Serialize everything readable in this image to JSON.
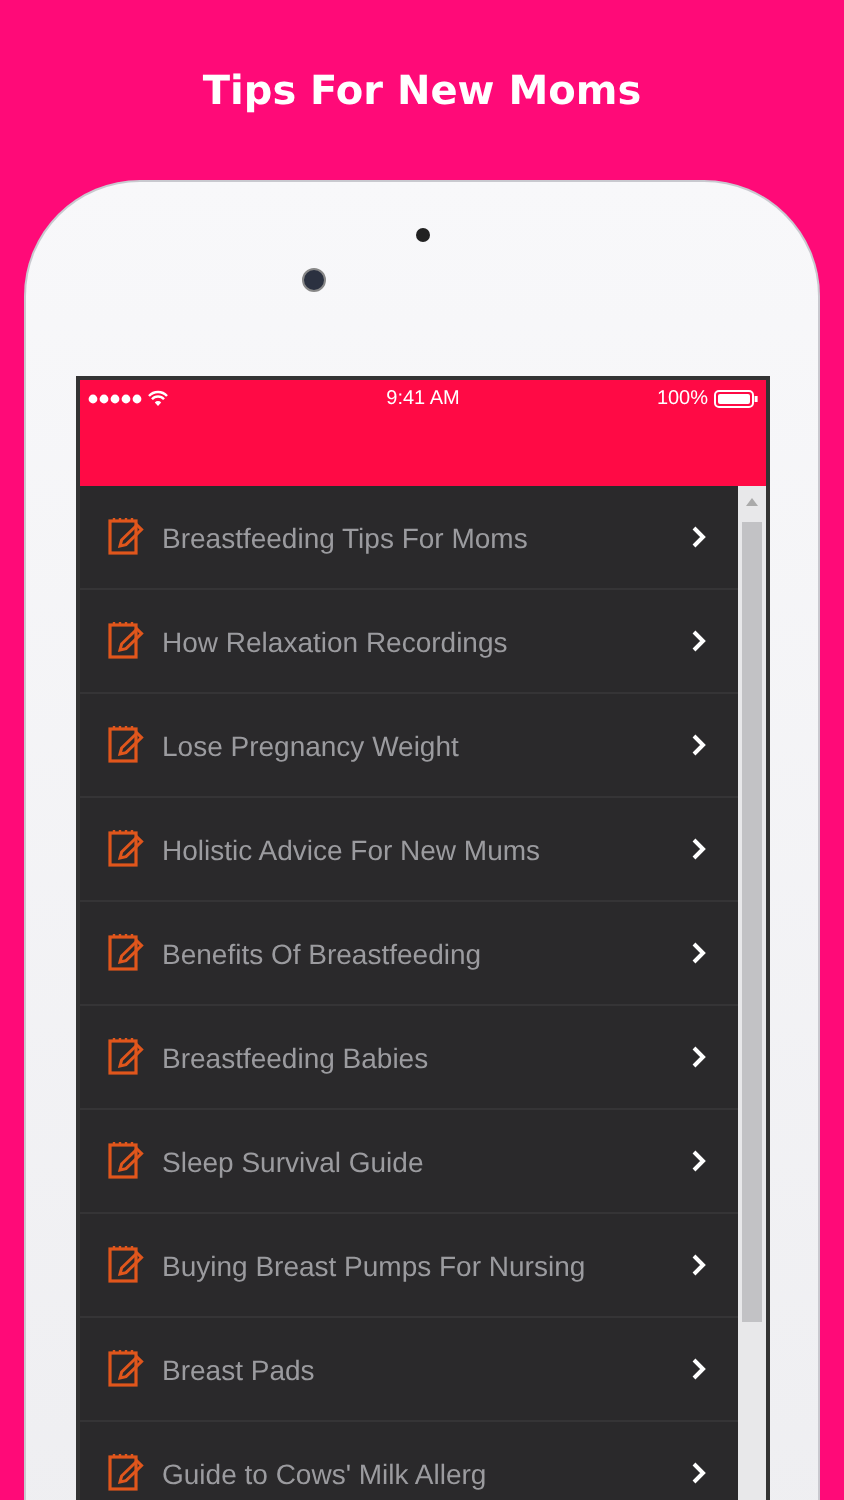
{
  "banner": {
    "title": "Tips For New Moms"
  },
  "status_bar": {
    "time": "9:41 AM",
    "battery": "100%"
  },
  "items": [
    {
      "label": "Breastfeeding Tips For Moms"
    },
    {
      "label": "How Relaxation Recordings"
    },
    {
      "label": "Lose Pregnancy Weight"
    },
    {
      "label": "Holistic Advice For New Mums"
    },
    {
      "label": "Benefits Of Breastfeeding"
    },
    {
      "label": "Breastfeeding Babies"
    },
    {
      "label": "Sleep Survival Guide"
    },
    {
      "label": "Buying Breast Pumps For Nursing"
    },
    {
      "label": "Breast Pads"
    },
    {
      "label": "Guide to Cows' Milk Allerg"
    }
  ]
}
